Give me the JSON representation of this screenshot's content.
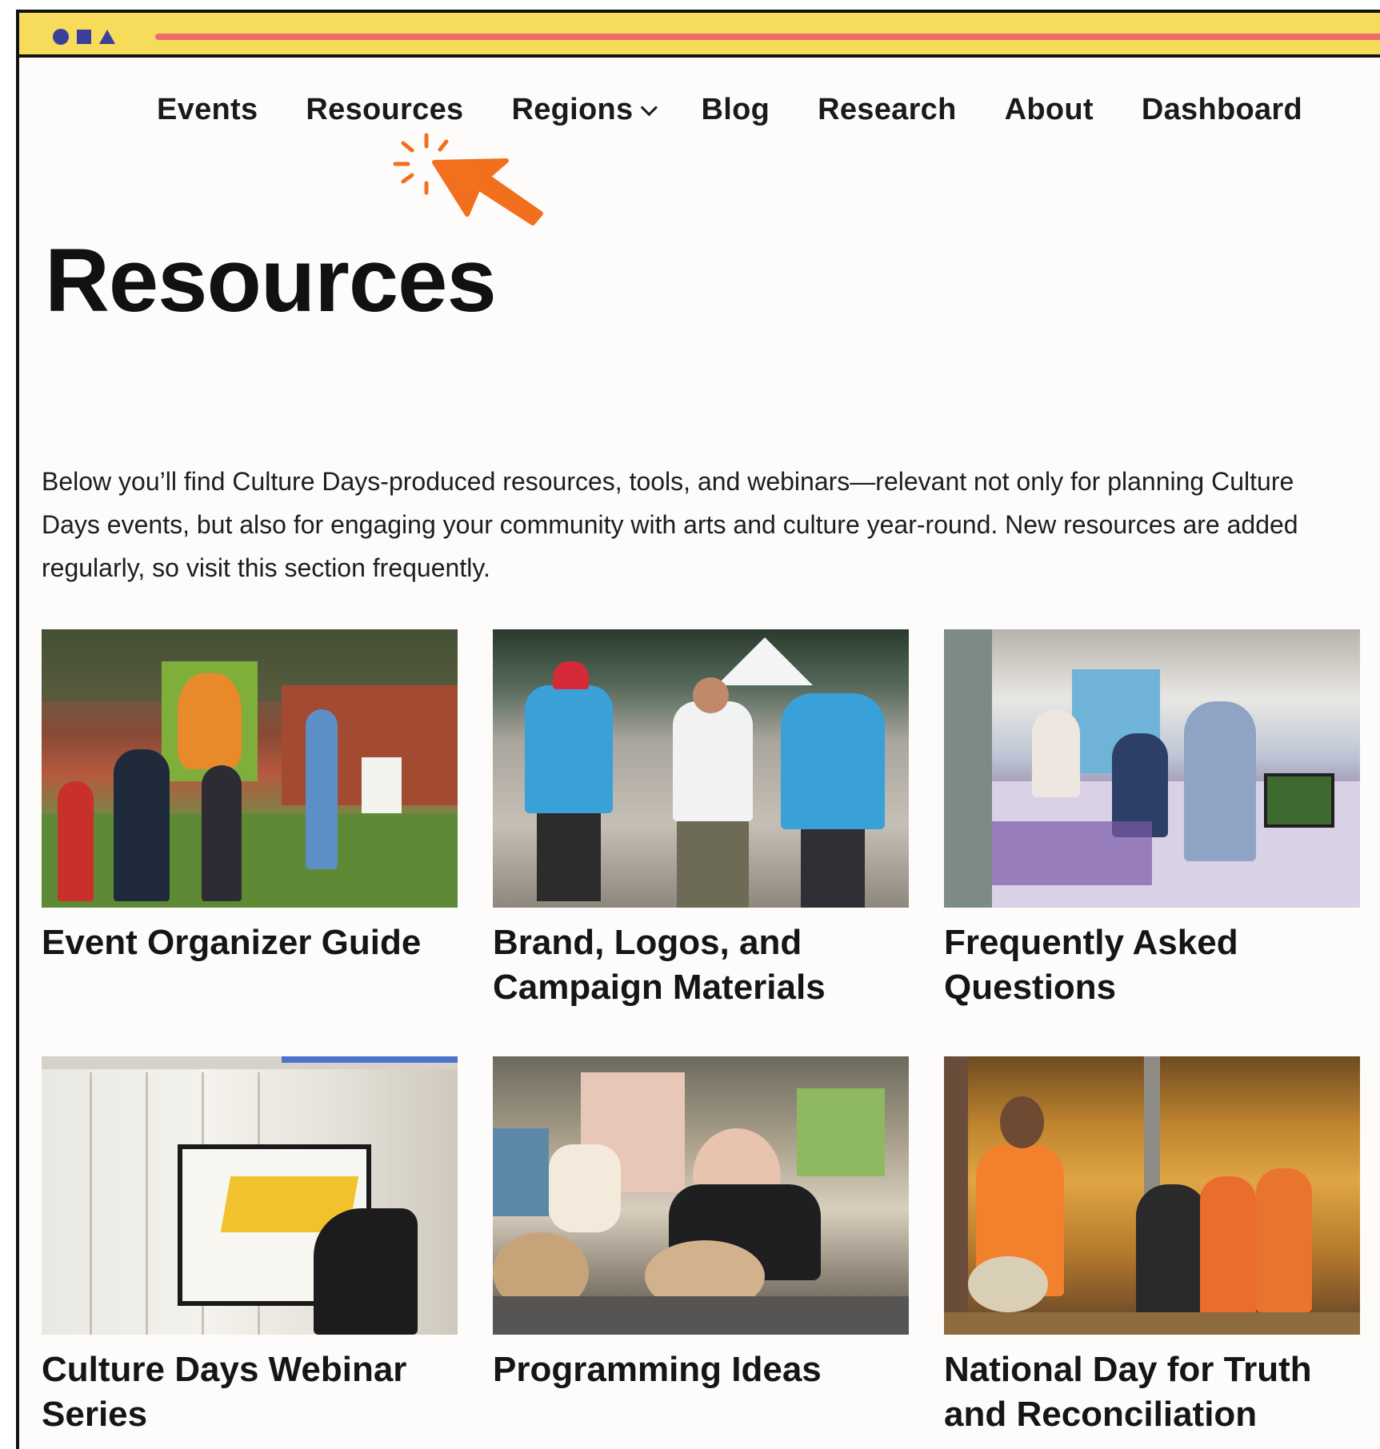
{
  "browser": {
    "accent_yellow": "#f7dc5b",
    "accent_red": "#f06b6b",
    "accent_blue": "#3b3f9c"
  },
  "nav": {
    "items": [
      {
        "label": "Events"
      },
      {
        "label": "Resources"
      },
      {
        "label": "Regions"
      },
      {
        "label": "Blog"
      },
      {
        "label": "Research"
      },
      {
        "label": "About"
      },
      {
        "label": "Dashboard"
      }
    ]
  },
  "cursor": {
    "icon": "click-pointer-icon",
    "color": "#f26f1d"
  },
  "page": {
    "title": "Resources",
    "intro": "Below you’ll find Culture Days-produced resources, tools, and webinars—relevant not only for planning Culture Days events, but also for engaging your community with arts and culture year-round. New resources are added regularly, so visit this section frequently."
  },
  "cards": [
    {
      "title": "Event Organizer Guide"
    },
    {
      "title": "Brand, Logos, and Campaign Materials"
    },
    {
      "title": "Frequently Asked Questions"
    },
    {
      "title": "Culture Days Webinar Series"
    },
    {
      "title": "Programming Ideas"
    },
    {
      "title": "National Day for Truth and Reconciliation"
    }
  ]
}
